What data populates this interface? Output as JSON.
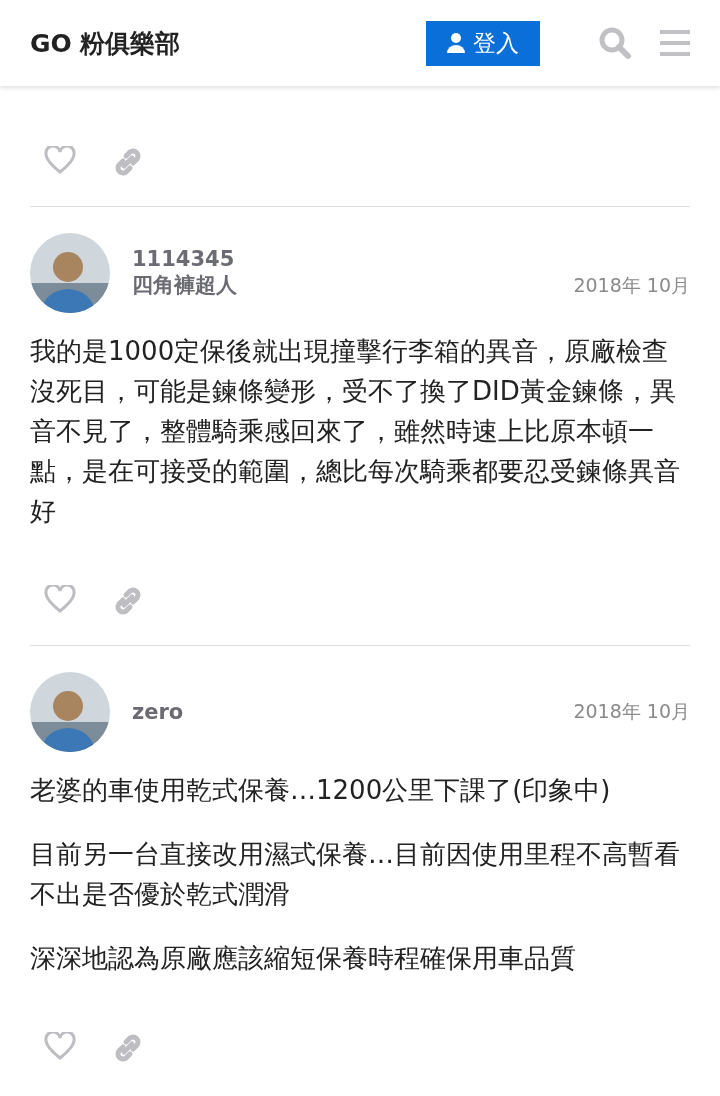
{
  "header": {
    "title": "GO 粉俱樂部",
    "login_button": "登入"
  },
  "posts": [
    {
      "liked": false
    },
    {
      "author": {
        "username": "1114345",
        "title": "四角褲超人"
      },
      "date": "2018年 10月",
      "paragraphs": [
        "我的是1000定保後就出現撞擊行李箱的異音，原廠檢查沒死目，可能是鍊條變形，受不了換了DID黃金鍊條，異音不見了，整體騎乘感回來了，雖然時速上比原本頓一點，是在可接受的範圍，總比每次騎乘都要忍受鍊條異音好"
      ],
      "liked": false
    },
    {
      "author": {
        "username": "zero"
      },
      "date": "2018年 10月",
      "paragraphs": [
        "老婆的車使用乾式保養…1200公里下課了(印象中)",
        "目前另一台直接改用濕式保養…目前因使用里程不高暫看不出是否優於乾式潤滑",
        "深深地認為原廠應該縮短保養時程確保用車品質"
      ],
      "liked": false
    }
  ]
}
